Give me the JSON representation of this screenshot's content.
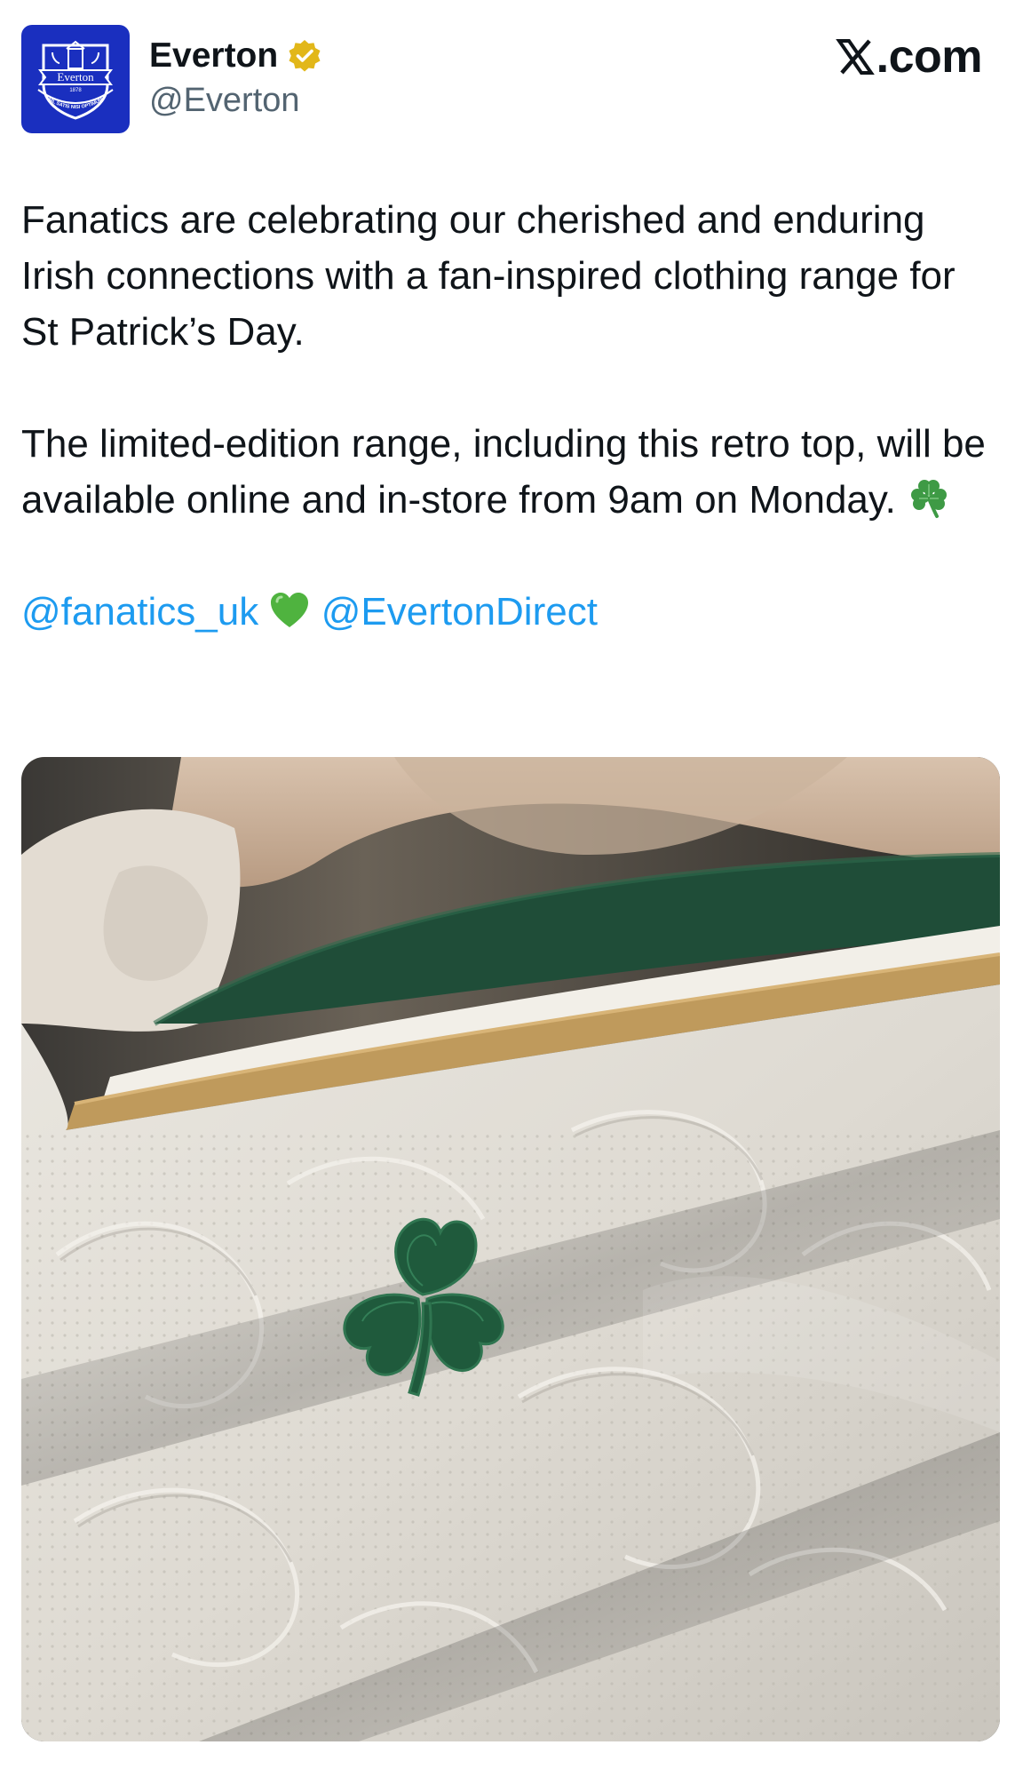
{
  "account": {
    "display_name": "Everton",
    "handle": "@Everton",
    "verified_badge": "gold-check-icon",
    "avatar_icon": "everton-crest-icon",
    "crest_text": "Everton",
    "crest_year": "1878",
    "crest_motto": "NIL SATIS NISI OPTIMUM"
  },
  "brand": {
    "label": "𝕏.com",
    "suffix": ".com"
  },
  "tweet": {
    "paragraph_1": "Fanatics are celebrating our cherished and enduring Irish connections with a fan-inspired clothing range for St Patrick’s Day.",
    "paragraph_2": "The limited-edition range, including this retro top, will be available online and in-store from 9am on Monday.",
    "paragraph_2_emoji": "shamrock-icon",
    "mention_1": "@fanatics_uk",
    "mention_separator_emoji": "green-heart-icon",
    "mention_2": "@EvertonDirect"
  },
  "media": {
    "image": "white-shirt-shamrock-photo"
  },
  "colors": {
    "text": "#0f1419",
    "secondary_text": "#536471",
    "link": "#1d9bf0",
    "crest_blue": "#1a2fbf",
    "badge_gold": "#e2b719",
    "shamrock_green": "#2a6b3c"
  }
}
